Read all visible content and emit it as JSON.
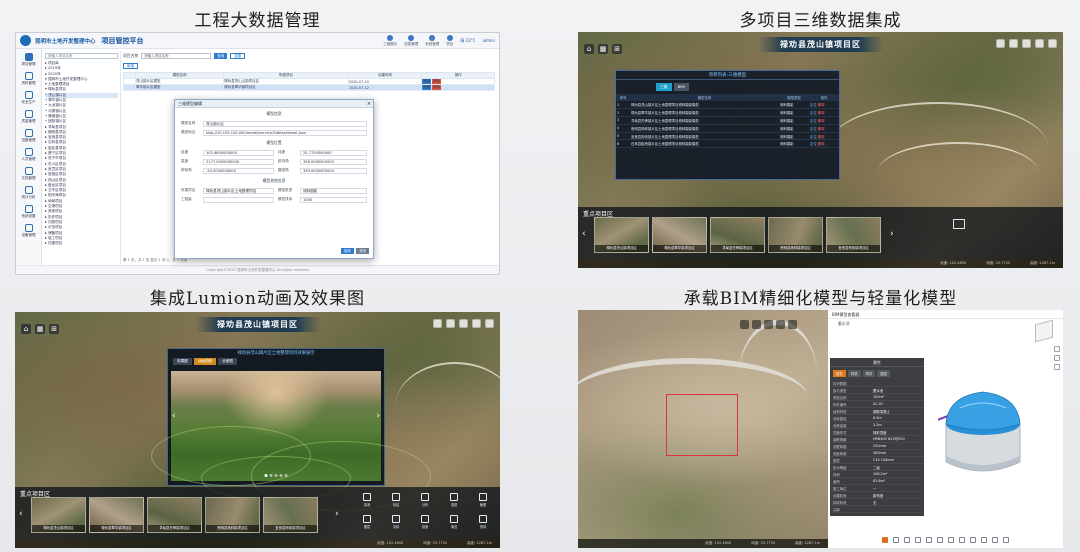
{
  "captions": {
    "tl": "工程大数据管理",
    "tr": "多项目三维数据集成",
    "bl": "集成Lumion动画及效果图",
    "br": "承载BIM精细化模型与轻量化模型"
  },
  "admin": {
    "org": "昆明市土地开发整理中心",
    "platform": "项目管控平台",
    "header_items": [
      "三维展示",
      "信息管理",
      "系统管理",
      "项目"
    ],
    "weather": "晴 23°C",
    "user": "admin",
    "sidebar": [
      "项目管理",
      "资料管理",
      "安全生产",
      "质量管理",
      "进度管理",
      "人员管理",
      "文档管理",
      "统计分析",
      "系统设置",
      "设备管理"
    ],
    "tree_search": "请输入项目名称",
    "tree": [
      "▸ 项目库",
      "  ▸ 2019年",
      "  ▸ 2020年",
      "▾ 昆明市土地开发整理中心",
      "  ▾ 土地整理项目",
      "    ▾ 禄劝县项目",
      "      • 茂山镇片区",
      "      • 翠华镇片区",
      "      • 九龙镇片区",
      "      • 中屏镇片区",
      "      • 撒营盘片区",
      "      • 团街镇片区",
      "    ▸ 寻甸县项目",
      "    ▸ 嵩明县项目",
      "    ▸ 宜良县项目",
      "    ▸ 石林县项目",
      "    ▸ 富民县项目",
      "    ▸ 晋宁区项目",
      "    ▸ 安宁市项目",
      "    ▸ 东川区项目",
      "    ▸ 呈贡区项目",
      "    ▸ 官渡区项目",
      "    ▸ 西山区项目",
      "    ▸ 盘龙区项目",
      "    ▸ 五华区项目",
      "    ▸ 阳宗海项目",
      "    ▸ 倘甸项目",
      "    ▸ 空港项目",
      "    ▸ 其他项目",
      "    ▸ 历史项目",
      "    ▸ 归档项目",
      "    ▸ 示范项目",
      "    ▸ 储备项目",
      "    ▸ 竣工项目",
      "    ▸ 在建项目"
    ],
    "filter_label": "项目名称",
    "filter_placeholder": "请输入项目名称",
    "search_label": "查询",
    "reset_label": "重置",
    "add_label": "新增",
    "table_headers": [
      "模型名称",
      "所属项目",
      "创建时间",
      "操作"
    ],
    "table_rows": [
      [
        "茂山镇片区模型",
        "禄劝县茂山山镇项目区",
        "2020-07-10",
        ""
      ],
      [
        "翠华镇片区模型",
        "禄劝县翠华镇项目区",
        "2020-07-12",
        ""
      ]
    ],
    "op_edit": "编辑",
    "op_delete": "删除",
    "pager": "第 1 页，共 1 页 显示 1 到 2，共 2 记录",
    "footer": "Copyright©2020 昆明市土地开发整理中心 All rights reserved",
    "dialog": {
      "title": "三维模型编辑",
      "section1": "模型信息",
      "name_label": "模型名称",
      "name_val": "茂山镇片区",
      "url_label": "模型地址",
      "url_val": "http://10.155.120.000/model/service/3dtiles/tileset.json",
      "section2": "模型位置",
      "lng_label": "经度",
      "lng_val": "102.4650000000",
      "lat_label": "纬度",
      "lat_val": "25.7750000000",
      "h_label": "高度",
      "h_val": "2177.0000000000",
      "heading_label": "航向角",
      "heading_val": "358.0000000000",
      "pitch_label": "俯仰角",
      "pitch_val": "-20.0000000000",
      "roll_label": "翻滚角",
      "roll_val": "359.0000000000",
      "section3": "模型其他信息",
      "project_label": "所属项目",
      "project_val": "禄劝县茂山镇片区土地整理项目",
      "type_label": "模型类型",
      "type_val": "倾斜摄影",
      "remark_label": "工程量",
      "remark_val": "",
      "sort_label": "模型排序",
      "sort_val": "1000",
      "save_label": "保存",
      "close_label": "关闭"
    }
  },
  "multi3d": {
    "scene_title": "禄劝县茂山镇项目区",
    "list_title": "项目列表-三维模型",
    "tabs": [
      "三维",
      "BIM"
    ],
    "headers": [
      "序号",
      "模型名称",
      "模型类型",
      "操作"
    ],
    "rows": [
      [
        "1",
        "禄劝县茂山镇片区土地整理项目倾斜摄影模型",
        "倾斜摄影",
        "定位",
        "删除"
      ],
      [
        "2",
        "禄劝县翠华镇片区土地整理项目倾斜摄影模型",
        "倾斜摄影",
        "定位",
        "删除"
      ],
      [
        "3",
        "寻甸县先锋镇片区土地整理项目倾斜摄影模型",
        "倾斜摄影",
        "定位",
        "删除"
      ],
      [
        "4",
        "嵩明县杨林镇片区土地整理项目倾斜摄影模型",
        "倾斜摄影",
        "定位",
        "删除"
      ],
      [
        "5",
        "宜良县狗街镇片区土地整理项目倾斜摄影模型",
        "倾斜摄影",
        "定位",
        "删除"
      ],
      [
        "6",
        "石林县板桥镇片区土地整理项目倾斜摄影模型",
        "倾斜摄影",
        "定位",
        "删除"
      ]
    ],
    "strip_label": "重点项目区",
    "thumbs": [
      "禄劝县茂山镇项目区",
      "禄劝县翠华镇项目区",
      "寻甸县先锋镇项目区",
      "嵩明县杨林镇项目区",
      "宜良县狗街镇项目区"
    ],
    "status": [
      "经度: 102.4650",
      "纬度: 25.7750",
      "高度: 2287.1m"
    ]
  },
  "lumion": {
    "scene_title": "禄劝县茂山镇项目区",
    "dialog_title": "禄劝县茂山镇片区土地整理项目效果展示",
    "tabs": [
      "效果图",
      "动画视频",
      "全景图"
    ],
    "strip_label": "重点项目区",
    "thumbs": [
      "禄劝县茂山镇项目区",
      "禄劝县翠华镇项目区",
      "寻甸县先锋镇项目区",
      "嵩明县杨林镇项目区",
      "宜良县狗街镇项目区"
    ],
    "tools": [
      "量测",
      "标绘",
      "分析",
      "漫游",
      "截图",
      "图层",
      "清除",
      "剖面",
      "淹没",
      "视域"
    ],
    "status": [
      "经度: 102.4650",
      "纬度: 25.7750",
      "高度: 2287.1m"
    ]
  },
  "bim": {
    "panel_title": "BIM模型查看器",
    "panel_sub": "蓄水池",
    "props_title": "属性",
    "props_tabs": [
      "属性",
      "材质",
      "构件",
      "图层"
    ],
    "props": [
      [
        "标识数据",
        ""
      ],
      [
        "族与类型",
        "蓄水池"
      ],
      [
        "类型名称",
        "100m³"
      ],
      [
        "构件编号",
        "SC-01"
      ],
      [
        "结构材质",
        "钢筋混凝土"
      ],
      [
        "池体直径",
        "6.5m"
      ],
      [
        "池体高度",
        "3.2m"
      ],
      [
        "顶盖形式",
        "球形顶盖"
      ],
      [
        "钢筋规格",
        "HRB400 Φ12@200"
      ],
      [
        "池壁厚度",
        "250mm"
      ],
      [
        "底板厚度",
        "300mm"
      ],
      [
        "垫层",
        "C15 100mm"
      ],
      [
        "防水等级",
        "二级"
      ],
      [
        "体积",
        "106.2m³"
      ],
      [
        "面积",
        "82.6m²"
      ],
      [
        "施工单位",
        "—"
      ],
      [
        "创建阶段",
        "新构造"
      ],
      [
        "拆除阶段",
        "无"
      ],
      [
        "注释",
        ""
      ]
    ],
    "status": [
      "经度: 102.4650",
      "纬度: 25.7750",
      "高度: 2287.1m"
    ]
  }
}
